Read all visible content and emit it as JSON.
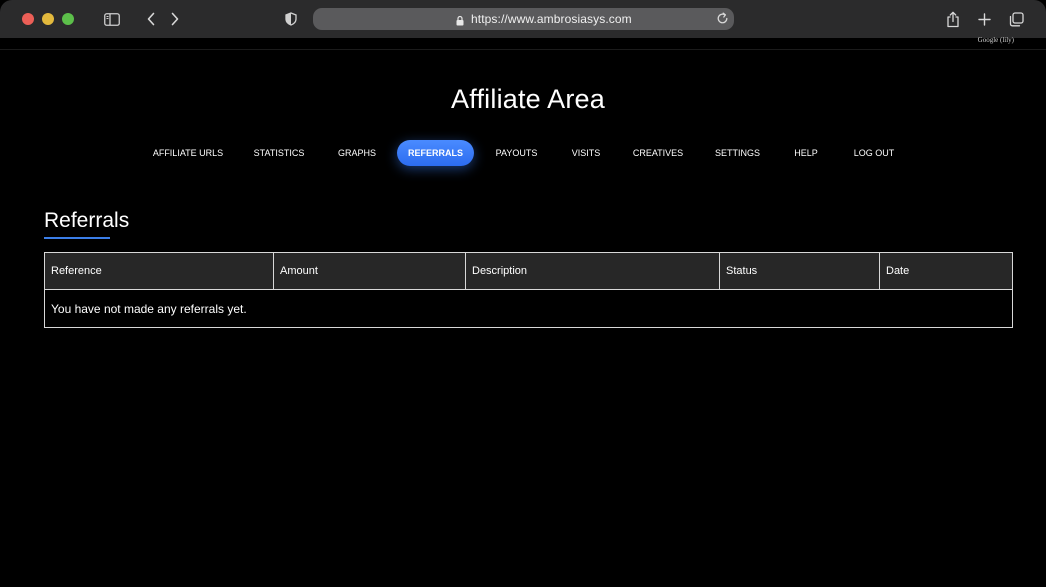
{
  "browser": {
    "url": "https://www.ambrosiasys.com",
    "icons": [
      "close-dot",
      "minimize-dot",
      "maximize-dot",
      "sidebar-icon",
      "back-chevron-icon",
      "forward-chevron-icon",
      "shield-icon",
      "lock-icon",
      "reload-icon",
      "share-icon",
      "plus-icon",
      "tabs-icon"
    ],
    "google_tag": "Google (lily)"
  },
  "page": {
    "title": "Affiliate Area"
  },
  "nav": {
    "items": [
      {
        "label": "AFFILIATE URLS",
        "active": false
      },
      {
        "label": "STATISTICS",
        "active": false
      },
      {
        "label": "GRAPHS",
        "active": false
      },
      {
        "label": "REFERRALS",
        "active": true
      },
      {
        "label": "PAYOUTS",
        "active": false
      },
      {
        "label": "VISITS",
        "active": false
      },
      {
        "label": "CREATIVES",
        "active": false
      },
      {
        "label": "SETTINGS",
        "active": false
      },
      {
        "label": "HELP",
        "active": false
      },
      {
        "label": "LOG OUT",
        "active": false
      }
    ],
    "active_color": "#3b7ef5"
  },
  "referrals": {
    "heading": "Referrals",
    "columns": [
      "Reference",
      "Amount",
      "Description",
      "Status",
      "Date"
    ],
    "empty_message": "You have not made any referrals yet."
  }
}
